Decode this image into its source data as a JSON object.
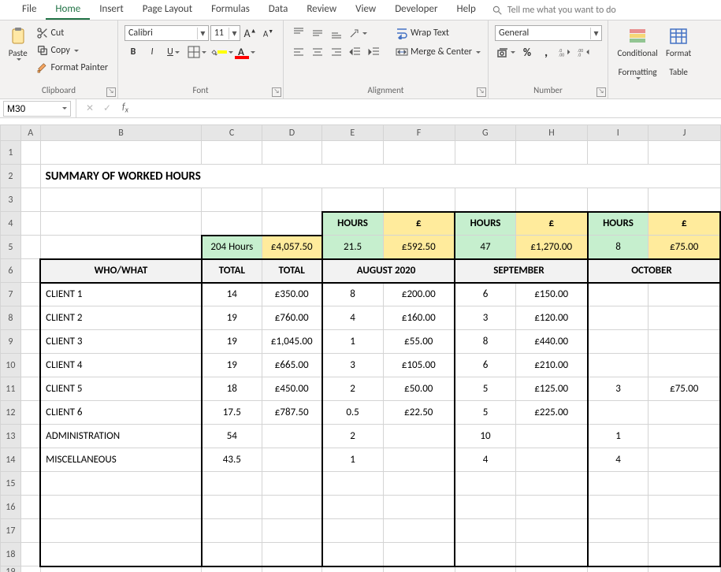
{
  "tabs": [
    "File",
    "Home",
    "Insert",
    "Page Layout",
    "Formulas",
    "Data",
    "Review",
    "View",
    "Developer",
    "Help"
  ],
  "active_tab": "Home",
  "tellme": "Tell me what you want to do",
  "clipboard": {
    "paste": "Paste",
    "cut": "Cut",
    "copy": "Copy",
    "fp": "Format Painter",
    "label": "Clipboard"
  },
  "font": {
    "name": "Calibri",
    "size": "11",
    "inc": "A",
    "dec": "A",
    "bold": "B",
    "italic": "I",
    "underline": "U",
    "label": "Font"
  },
  "align": {
    "wrap": "Wrap Text",
    "merge": "Merge & Center",
    "label": "Alignment"
  },
  "number": {
    "format": "General",
    "label": "Number"
  },
  "styles": {
    "cond": "Conditional Formatting",
    "cond1": "Conditional",
    "cond2": "Formatting",
    "table1": "Format",
    "table2": "Table"
  },
  "namebox": "M30",
  "chart_data": {
    "type": "table",
    "title": "SUMMARY OF WORKED HOURS",
    "period_headers": [
      "AUGUST 2020",
      "SEPTEMBER",
      "OCTOBER"
    ],
    "metric_headers": [
      "HOURS",
      "£"
    ],
    "totals_label_hours": "204 Hours",
    "totals_label_money": "£4,057.50",
    "period_hours": [
      "21.5",
      "47",
      "8"
    ],
    "period_money": [
      "£592.50",
      "£1,270.00",
      "£75.00"
    ],
    "who_what": "WHO/WHAT",
    "total": "TOTAL",
    "rows": [
      {
        "name": "CLIENT 1",
        "c": "14",
        "d": "£350.00",
        "e": "8",
        "f": "£200.00",
        "g": "6",
        "h": "£150.00",
        "i": "",
        "j": ""
      },
      {
        "name": "CLIENT 2",
        "c": "19",
        "d": "£760.00",
        "e": "4",
        "f": "£160.00",
        "g": "3",
        "h": "£120.00",
        "i": "",
        "j": ""
      },
      {
        "name": "CLIENT 3",
        "c": "19",
        "d": "£1,045.00",
        "e": "1",
        "f": "£55.00",
        "g": "8",
        "h": "£440.00",
        "i": "",
        "j": ""
      },
      {
        "name": "CLIENT 4",
        "c": "19",
        "d": "£665.00",
        "e": "3",
        "f": "£105.00",
        "g": "6",
        "h": "£210.00",
        "i": "",
        "j": ""
      },
      {
        "name": "CLIENT 5",
        "c": "18",
        "d": "£450.00",
        "e": "2",
        "f": "£50.00",
        "g": "5",
        "h": "£125.00",
        "i": "3",
        "j": "£75.00"
      },
      {
        "name": "CLIENT 6",
        "c": "17.5",
        "d": "£787.50",
        "e": "0.5",
        "f": "£22.50",
        "g": "5",
        "h": "£225.00",
        "i": "",
        "j": ""
      },
      {
        "name": "ADMINISTRATION",
        "c": "54",
        "d": "",
        "e": "2",
        "f": "",
        "g": "10",
        "h": "",
        "i": "1",
        "j": ""
      },
      {
        "name": "MISCELLANEOUS",
        "c": "43.5",
        "d": "",
        "e": "1",
        "f": "",
        "g": "4",
        "h": "",
        "i": "4",
        "j": ""
      }
    ]
  }
}
